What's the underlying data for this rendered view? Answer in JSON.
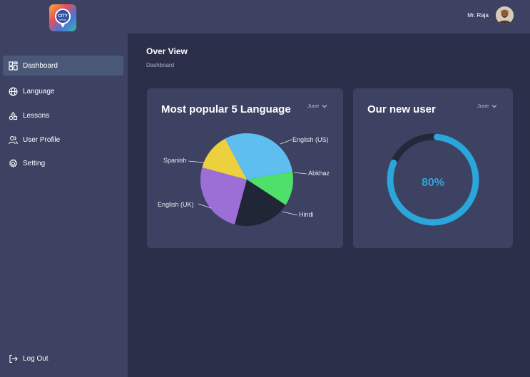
{
  "brand": {
    "logo_text_top": "CITY",
    "logo_text_bottom": "SPEAK"
  },
  "sidebar": {
    "items": [
      {
        "label": "Dashboard",
        "icon": "dashboard-grid-icon",
        "active": true
      },
      {
        "label": "Language",
        "icon": "globe-icon",
        "active": false
      },
      {
        "label": "Lessons",
        "icon": "lessons-shapes-icon",
        "active": false
      },
      {
        "label": "User Profile",
        "icon": "users-icon",
        "active": false
      },
      {
        "label": "Setting",
        "icon": "gear-icon",
        "active": false
      }
    ],
    "logout_label": "Log Out"
  },
  "header": {
    "user_name": "Mr. Raja"
  },
  "page": {
    "title": "Over View",
    "breadcrumb": "Dashboard"
  },
  "language_card": {
    "title": "Most popular 5 Language",
    "period": "June",
    "labels": {
      "english_us": "English (US)",
      "abkhaz": "Abkhaz",
      "hindi": "Hindi",
      "english_uk": "English (UK)",
      "spanish": "Spanish"
    }
  },
  "users_card": {
    "title": "Our new user",
    "period": "June",
    "value_label": "80%"
  },
  "chart_data": [
    {
      "type": "pie",
      "title": "Most popular 5 Language",
      "slices": [
        {
          "label": "English (US)",
          "value": 30,
          "color": "#5ebef0"
        },
        {
          "label": "Abkhaz",
          "value": 12,
          "color": "#4fe06a"
        },
        {
          "label": "Hindi",
          "value": 20,
          "color": "#202636"
        },
        {
          "label": "English (UK)",
          "value": 25,
          "color": "#9c6fd6"
        },
        {
          "label": "Spanish",
          "value": 13,
          "color": "#ecd03e"
        }
      ]
    },
    {
      "type": "gauge",
      "title": "Our new user",
      "value": 80,
      "max": 100,
      "color": "#2aa6db",
      "track_color": "#23283b"
    }
  ]
}
